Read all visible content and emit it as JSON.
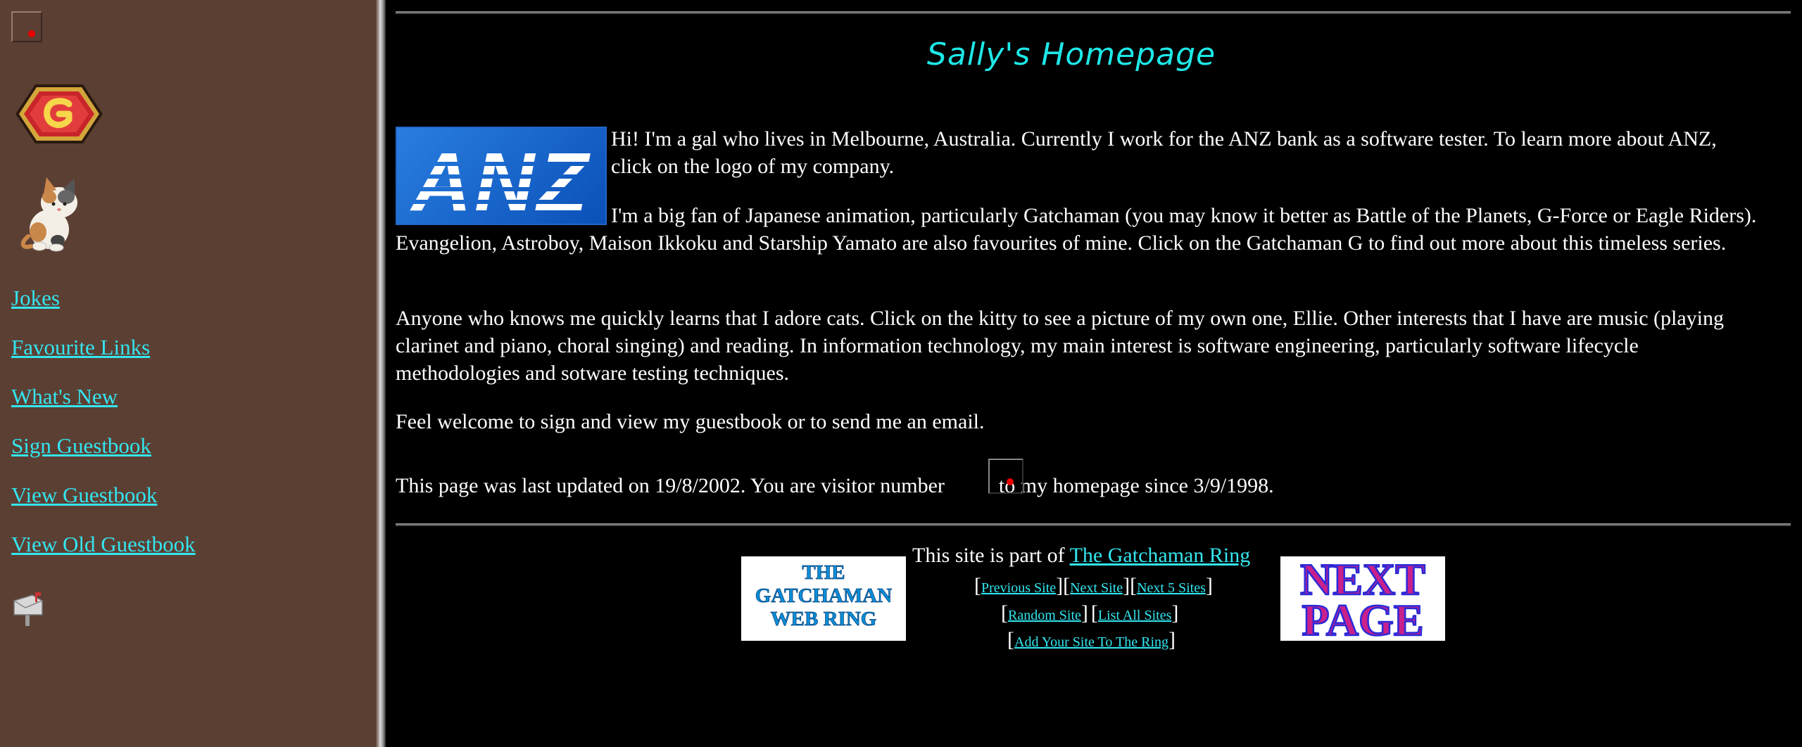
{
  "sidebar": {
    "links": [
      {
        "label": "Jokes"
      },
      {
        "label": "Favourite Links"
      },
      {
        "label": "What's New"
      },
      {
        "label": "Sign Guestbook"
      },
      {
        "label": "View Guestbook"
      },
      {
        "label": "View Old Guestbook"
      }
    ]
  },
  "main": {
    "title": "Sally's Homepage",
    "intro": "Hi! I'm a gal who lives in Melbourne, Australia. Currently I work for the ANZ bank as a software tester. To learn more about ANZ, click on the logo of my company.",
    "anime": "I'm a big fan of Japanese animation, particularly Gatchaman (you may know it better as Battle of the Planets, G-Force or Eagle Riders). Evangelion, Astroboy, Maison Ikkoku and Starship Yamato are also favourites of mine. Click on the Gatchaman G to find out more about this timeless series.",
    "cats": "Anyone who knows me quickly learns that I adore cats. Click on the kitty to see a picture of my own one, Ellie. Other interests that I have are music (playing clarinet and piano, choral singing) and reading. In information technology, my main interest is software engineering, particularly software lifecycle methodologies and sotware testing techniques.",
    "welcome": "Feel welcome to sign and view my guestbook or to send me an email.",
    "updated_prefix": "This page was last updated on 19/8/2002. You are visitor number",
    "updated_suffix": "to my homepage since 3/9/1998.",
    "logo_text": "ANZ"
  },
  "webring": {
    "intro": "This site is part of",
    "ring_link": "The Gatchaman Ring",
    "previous": "Previous Site",
    "next": "Next Site",
    "next5": "Next 5 Sites",
    "random": "Random Site",
    "list_all": "List All Sites",
    "add_site": "Add Your Site To The Ring",
    "banner_left": [
      "THE",
      "GATCHAMAN",
      "WEB RING"
    ],
    "banner_right": [
      "NEXT",
      "PAGE"
    ]
  },
  "colors": {
    "sidebar_bg": "#5c3f33",
    "link": "#33e6f0",
    "title": "#1ee8e8",
    "page_bg": "#000000"
  },
  "icons": [
    "broken-image-icon",
    "gatchaman-g-icon",
    "cat-icon",
    "envelope-icon"
  ]
}
